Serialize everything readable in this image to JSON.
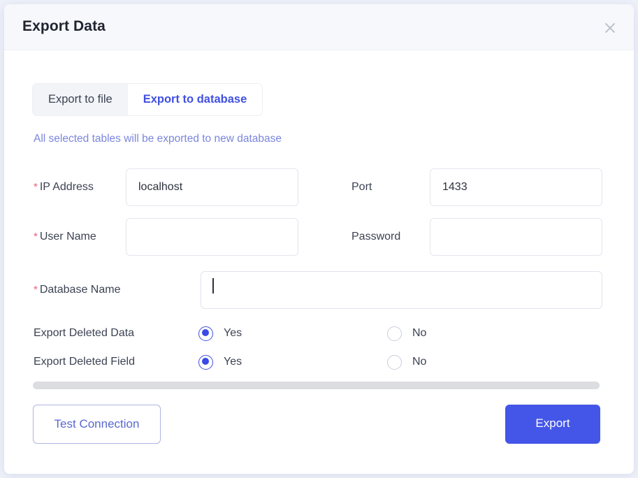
{
  "dialog": {
    "title": "Export Data",
    "close_icon": "close-icon"
  },
  "tabs": [
    {
      "label": "Export to file",
      "active": false
    },
    {
      "label": "Export to database",
      "active": true
    }
  ],
  "description": "All selected tables will be exported to new database",
  "form": {
    "ip_address": {
      "label": "IP Address",
      "required_marker": "*",
      "value": "localhost",
      "placeholder": ""
    },
    "port": {
      "label": "Port",
      "value": "1433",
      "placeholder": ""
    },
    "user_name": {
      "label": "User Name",
      "required_marker": "*",
      "value": "",
      "placeholder": ""
    },
    "password": {
      "label": "Password",
      "value": "",
      "placeholder": ""
    },
    "database_name": {
      "label": "Database Name",
      "required_marker": "*",
      "value": "",
      "placeholder": ""
    }
  },
  "options": {
    "export_deleted_data": {
      "label": "Export Deleted Data",
      "yes_label": "Yes",
      "no_label": "No",
      "selected": "Yes"
    },
    "export_deleted_field": {
      "label": "Export Deleted Field",
      "yes_label": "Yes",
      "no_label": "No",
      "selected": "Yes"
    }
  },
  "footer": {
    "test_connection_label": "Test Connection",
    "export_label": "Export"
  },
  "colors": {
    "accent": "#4456e8",
    "accent_text": "#4050e0",
    "description_text": "#7b86dd",
    "required_marker": "#e8607b",
    "header_bg": "#f7f8fc",
    "tab_inactive_bg": "#f2f4f8",
    "scrollbar": "#dcdde0"
  }
}
